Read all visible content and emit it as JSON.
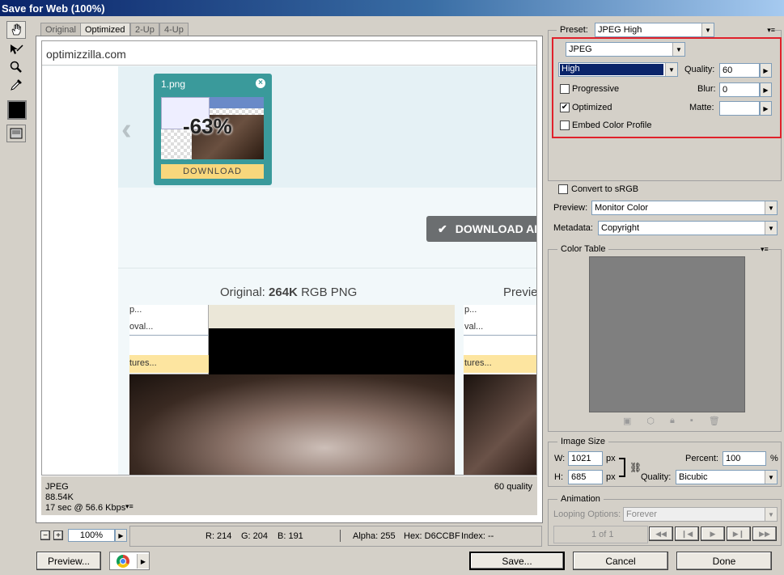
{
  "window": {
    "title": "Save for Web (100%)"
  },
  "tabs": [
    {
      "label": "Original"
    },
    {
      "label": "Optimized"
    },
    {
      "label": "2-Up"
    },
    {
      "label": "4-Up"
    }
  ],
  "webpage": {
    "site_name": "optimizzilla.com",
    "thumb_filename": "1.png",
    "thumb_savings": "-63%",
    "download_button": "DOWNLOAD",
    "download_all_button": "DOWNLOAD AL",
    "original_prefix": "Original:",
    "original_size": "264K",
    "original_suffix": "RGB PNG",
    "preview_label": "Previe",
    "menu_items": [
      "p...",
      "oval...",
      "tures..."
    ],
    "menu_items_right": [
      "p...",
      "val...",
      "tures..."
    ]
  },
  "canvas_info": {
    "format": "JPEG",
    "size": "88.54K",
    "download_time": "17 sec @ 56.6 Kbps",
    "quality_label": "60 quality"
  },
  "statusbar": {
    "zoom": "100%",
    "r": "R: 214",
    "g": "G: 204",
    "b": "B: 191",
    "alpha": "Alpha: 255",
    "hex": "Hex: D6CCBF",
    "index": "Index: --"
  },
  "bottom_buttons": {
    "preview": "Preview...",
    "save": "Save...",
    "cancel": "Cancel",
    "done": "Done"
  },
  "settings": {
    "preset_label": "Preset:",
    "preset_value": "JPEG High",
    "format_value": "JPEG",
    "compression_value": "High",
    "quality_label": "Quality:",
    "quality_value": "60",
    "blur_label": "Blur:",
    "blur_value": "0",
    "matte_label": "Matte:",
    "progressive_label": "Progressive",
    "progressive_checked": false,
    "optimized_label": "Optimized",
    "optimized_checked": true,
    "embed_label": "Embed Color Profile",
    "embed_checked": false,
    "srgb_label": "Convert to sRGB",
    "preview_label": "Preview:",
    "preview_value": "Monitor Color",
    "metadata_label": "Metadata:",
    "metadata_value": "Copyright"
  },
  "color_table": {
    "title": "Color Table"
  },
  "image_size": {
    "title": "Image Size",
    "w_label": "W:",
    "w_value": "1021",
    "h_label": "H:",
    "h_value": "685",
    "px": "px",
    "percent_label": "Percent:",
    "percent_value": "100",
    "percent_unit": "%",
    "quality_label": "Quality:",
    "quality_value": "Bicubic"
  },
  "animation": {
    "title": "Animation",
    "looping_label": "Looping Options:",
    "looping_value": "Forever",
    "frame_counter": "1 of 1"
  },
  "colors": {
    "highlight_box": "#e0212b",
    "teal_card": "#3a9a9b",
    "download_yellow": "#f8d77c"
  }
}
